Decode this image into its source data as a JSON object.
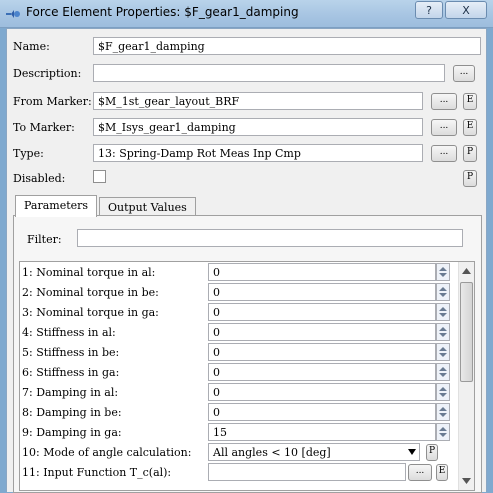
{
  "window": {
    "title": "Force Element Properties: $F_gear1_damping",
    "help_label": "?",
    "close_label": "X"
  },
  "form": {
    "name": {
      "label": "Name:",
      "value": "$F_gear1_damping"
    },
    "description": {
      "label": "Description:",
      "value": "",
      "button": "..."
    },
    "from_marker": {
      "label": "From Marker:",
      "value": "$M_1st_gear_layout_BRF",
      "button": "...",
      "extra": "E"
    },
    "to_marker": {
      "label": "To Marker:",
      "value": "$M_Isys_gear1_damping",
      "button": "...",
      "extra": "E"
    },
    "type": {
      "label": "Type:",
      "value": "13: Spring-Damp Rot Meas Inp Cmp",
      "button": "...",
      "extra": "P"
    },
    "disabled": {
      "label": "Disabled:",
      "checked": false,
      "extra": "P"
    }
  },
  "tabs": [
    {
      "label": "Parameters",
      "active": true
    },
    {
      "label": "Output Values",
      "active": false
    }
  ],
  "filter": {
    "label": "Filter:",
    "value": ""
  },
  "parameters": [
    {
      "label": "1: Nominal torque in al:",
      "value": "0"
    },
    {
      "label": "2: Nominal torque in be:",
      "value": "0"
    },
    {
      "label": "3: Nominal torque in ga:",
      "value": "0"
    },
    {
      "label": "4: Stiffness in al:",
      "value": "0"
    },
    {
      "label": "5: Stiffness in be:",
      "value": "0"
    },
    {
      "label": "6: Stiffness in ga:",
      "value": "0"
    },
    {
      "label": "7: Damping in al:",
      "value": "0"
    },
    {
      "label": "8: Damping in be:",
      "value": "0"
    },
    {
      "label": "9: Damping in ga:",
      "value": "15"
    },
    {
      "label": "10: Mode of angle calculation:",
      "value": "All angles < 10 [deg]",
      "extra": "P"
    },
    {
      "label": "11: Input Function T_c(al):",
      "value": "",
      "button": "...",
      "extra": "E"
    }
  ]
}
